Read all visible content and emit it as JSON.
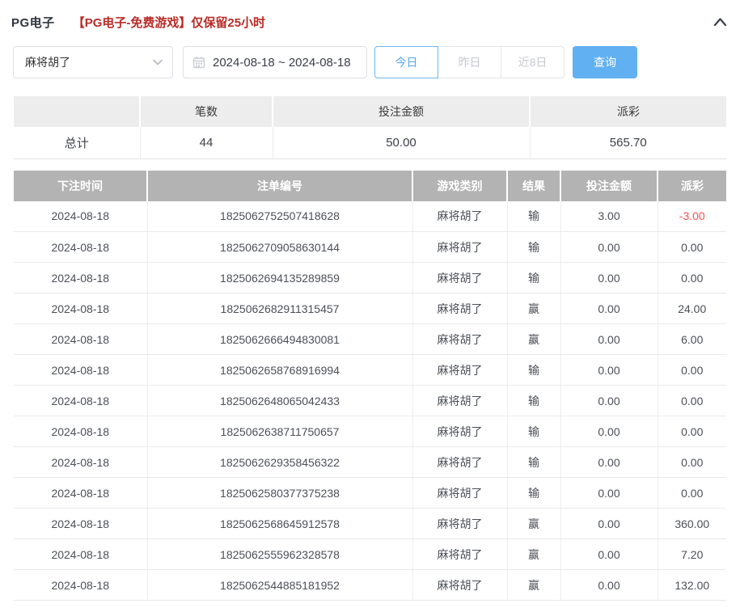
{
  "header": {
    "title": "PG电子",
    "notice": "【PG电子-免费游戏】仅保留25小时"
  },
  "filters": {
    "game_select": {
      "value": "麻将胡了"
    },
    "date_range": {
      "value": "2024-08-18 ~ 2024-08-18"
    },
    "quick_buttons": [
      {
        "label": "今日",
        "active": true
      },
      {
        "label": "昨日",
        "active": false
      },
      {
        "label": "近8日",
        "active": false
      }
    ],
    "search_label": "查询"
  },
  "summary": {
    "columns": [
      "",
      "笔数",
      "投注金额",
      "派彩"
    ],
    "total_label": "总计",
    "count": "44",
    "bet_amount": "50.00",
    "payout": "565.70"
  },
  "records": {
    "columns": [
      "下注时间",
      "注单编号",
      "游戏类别",
      "结果",
      "投注金额",
      "派彩"
    ],
    "rows": [
      {
        "date": "2024-08-18",
        "bet_id": "1825062752507418628",
        "game": "麻将胡了",
        "result": "输",
        "bet_amount": "3.00",
        "payout": "-3.00"
      },
      {
        "date": "2024-08-18",
        "bet_id": "1825062709058630144",
        "game": "麻将胡了",
        "result": "输",
        "bet_amount": "0.00",
        "payout": "0.00"
      },
      {
        "date": "2024-08-18",
        "bet_id": "1825062694135289859",
        "game": "麻将胡了",
        "result": "输",
        "bet_amount": "0.00",
        "payout": "0.00"
      },
      {
        "date": "2024-08-18",
        "bet_id": "1825062682911315457",
        "game": "麻将胡了",
        "result": "赢",
        "bet_amount": "0.00",
        "payout": "24.00"
      },
      {
        "date": "2024-08-18",
        "bet_id": "1825062666494830081",
        "game": "麻将胡了",
        "result": "赢",
        "bet_amount": "0.00",
        "payout": "6.00"
      },
      {
        "date": "2024-08-18",
        "bet_id": "1825062658768916994",
        "game": "麻将胡了",
        "result": "输",
        "bet_amount": "0.00",
        "payout": "0.00"
      },
      {
        "date": "2024-08-18",
        "bet_id": "1825062648065042433",
        "game": "麻将胡了",
        "result": "输",
        "bet_amount": "0.00",
        "payout": "0.00"
      },
      {
        "date": "2024-08-18",
        "bet_id": "1825062638711750657",
        "game": "麻将胡了",
        "result": "输",
        "bet_amount": "0.00",
        "payout": "0.00"
      },
      {
        "date": "2024-08-18",
        "bet_id": "1825062629358456322",
        "game": "麻将胡了",
        "result": "输",
        "bet_amount": "0.00",
        "payout": "0.00"
      },
      {
        "date": "2024-08-18",
        "bet_id": "1825062580377375238",
        "game": "麻将胡了",
        "result": "输",
        "bet_amount": "0.00",
        "payout": "0.00"
      },
      {
        "date": "2024-08-18",
        "bet_id": "1825062568645912578",
        "game": "麻将胡了",
        "result": "赢",
        "bet_amount": "0.00",
        "payout": "360.00"
      },
      {
        "date": "2024-08-18",
        "bet_id": "1825062555962328578",
        "game": "麻将胡了",
        "result": "赢",
        "bet_amount": "0.00",
        "payout": "7.20"
      },
      {
        "date": "2024-08-18",
        "bet_id": "1825062544885181952",
        "game": "麻将胡了",
        "result": "赢",
        "bet_amount": "0.00",
        "payout": "132.00"
      }
    ]
  },
  "colors": {
    "accent_blue": "#61b0f2",
    "active_border_blue": "#6db5f1",
    "notice_red": "#b92c27",
    "negative_red": "#f15353",
    "table_header_gray": "#b3b3b3",
    "summary_header_gray": "#ededed"
  }
}
